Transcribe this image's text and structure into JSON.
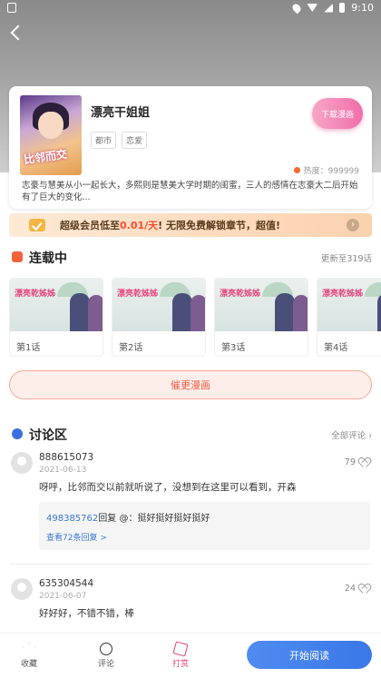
{
  "status_bar": {
    "time": "9:10"
  },
  "comic": {
    "title": "漂亮干姐姐",
    "cover_text": "比邻而交",
    "tags": [
      "都市",
      "恋爱"
    ],
    "download_label": "下载漫画",
    "heat_label": "热度：999999",
    "synopsis": "志豪与慧美从小一起长大，多熙则是慧美大学时期的闺蜜，三人的感情在志豪大二后开始有了巨大的变化..."
  },
  "vip_banner": {
    "prefix": "超级会员低至",
    "price": "0.01/天",
    "suffix": "! 无限免费解锁章节，超值!"
  },
  "serial": {
    "title": "连载中",
    "updated": "更新至319话",
    "episode_banner": "漂亮乾姊姊",
    "episodes": [
      "第1话",
      "第2话",
      "第3话",
      "第4话"
    ]
  },
  "urge_label": "催更漫画",
  "discussion": {
    "title": "讨论区",
    "all_label": "全部评论",
    "comments": [
      {
        "user": "888615073",
        "date": "2021-06-13",
        "likes": "79",
        "body": "呀呼，比邻而交以前就听说了，没想到在这里可以看到，开森",
        "reply_user": "498385762",
        "reply_text": "回复 @：挺好挺好挺好挺好",
        "reply_more": "查看72条回复 >"
      },
      {
        "user": "635304544",
        "date": "2021-06-07",
        "likes": "24",
        "body": "好好好，不错不错，棒"
      }
    ]
  },
  "bottom_bar": {
    "collect": "收藏",
    "comment": "评论",
    "reward": "打赏",
    "read": "开始阅读"
  },
  "colors": {
    "accent_pink": "#f06eaa",
    "read_blue": "#3a77e8",
    "urge_red": "#f05a45",
    "price_red": "#ff4a2e"
  },
  "icons": [
    "back-icon",
    "heat-dot-icon",
    "vip-check-icon",
    "serial-icon",
    "discussion-icon",
    "heart-icon",
    "star-icon",
    "chat-icon",
    "gift-icon"
  ]
}
